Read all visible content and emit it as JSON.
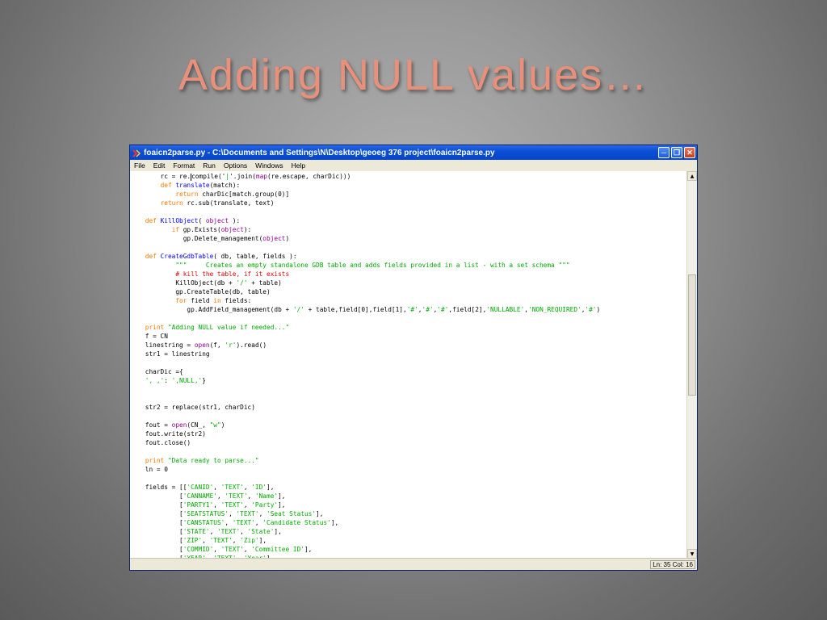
{
  "slide": {
    "title": "Adding NULL values…"
  },
  "window": {
    "title": "foaicn2parse.py - C:\\Documents and Settings\\N\\Desktop\\geoeg 376 project\\foaicn2parse.py",
    "menu": [
      "File",
      "Edit",
      "Format",
      "Run",
      "Options",
      "Windows",
      "Help"
    ],
    "status": "Ln: 35 Col: 16"
  },
  "code": [
    [
      [
        "",
        "        rc = re."
      ],
      [
        "",
        "compile"
      ],
      [
        "",
        "('"
      ],
      [
        "st",
        "|"
      ],
      [
        "",
        "'.join("
      ],
      [
        "bi",
        "map"
      ],
      [
        "",
        "(re.escape, charDic)))"
      ]
    ],
    [
      [
        "",
        "        "
      ],
      [
        "kw",
        "def "
      ],
      [
        "fn",
        "translate"
      ],
      [
        "",
        "(match):"
      ]
    ],
    [
      [
        "",
        "            "
      ],
      [
        "kw",
        "return "
      ],
      [
        "",
        "charDic[match.group(0)]"
      ]
    ],
    [
      [
        "",
        "        "
      ],
      [
        "kw",
        "return "
      ],
      [
        "",
        "rc.sub(translate, text)"
      ]
    ],
    [
      [
        "",
        ""
      ]
    ],
    [
      [
        "kw",
        "    def "
      ],
      [
        "fn",
        "KillObject"
      ],
      [
        "",
        "( "
      ],
      [
        "bi",
        "object"
      ],
      [
        "",
        " ):"
      ]
    ],
    [
      [
        "",
        "           "
      ],
      [
        "kw",
        "if "
      ],
      [
        "",
        "gp.Exists("
      ],
      [
        "bi",
        "object"
      ],
      [
        "",
        "):"
      ]
    ],
    [
      [
        "",
        "              gp.Delete_management("
      ],
      [
        "bi",
        "object"
      ],
      [
        "",
        ")"
      ]
    ],
    [
      [
        "",
        ""
      ]
    ],
    [
      [
        "kw",
        "    def "
      ],
      [
        "fn",
        "CreateGdbTable"
      ],
      [
        "",
        "( db, table, fields ):"
      ]
    ],
    [
      [
        "",
        "            "
      ],
      [
        "st",
        "\"\"\"     Creates an empty standalone GDB table and adds fields provided in a list - with a set schema \"\"\""
      ]
    ],
    [
      [
        "",
        "            "
      ],
      [
        "cm",
        "# kill the table, if it exists"
      ]
    ],
    [
      [
        "",
        "            KillObject(db + "
      ],
      [
        "st",
        "'/'"
      ],
      [
        "",
        " + table)"
      ]
    ],
    [
      [
        "",
        "            gp.CreateTable(db, table)"
      ]
    ],
    [
      [
        "",
        "            "
      ],
      [
        "kw",
        "for "
      ],
      [
        "",
        "field "
      ],
      [
        "kw",
        "in "
      ],
      [
        "",
        "fields:"
      ]
    ],
    [
      [
        "",
        "               gp.AddField_management(db + "
      ],
      [
        "st",
        "'/'"
      ],
      [
        "",
        " + table,field[0],field[1],"
      ],
      [
        "st",
        "'#'"
      ],
      [
        "",
        ","
      ],
      [
        "st",
        "'#'"
      ],
      [
        "",
        ","
      ],
      [
        "st",
        "'#'"
      ],
      [
        "",
        ",field[2],"
      ],
      [
        "st",
        "'NULLABLE'"
      ],
      [
        "",
        ","
      ],
      [
        "st",
        "'NON_REQUIRED'"
      ],
      [
        "",
        ","
      ],
      [
        "st",
        "'#'"
      ],
      [
        "",
        ")"
      ]
    ],
    [
      [
        "",
        ""
      ]
    ],
    [
      [
        "kw",
        "    print "
      ],
      [
        "st",
        "\"Adding NULL value if needed...\""
      ]
    ],
    [
      [
        "",
        "    f = CN"
      ]
    ],
    [
      [
        "",
        "    linestring = "
      ],
      [
        "bi",
        "open"
      ],
      [
        "",
        "(f, "
      ],
      [
        "st",
        "'r'"
      ],
      [
        "",
        ").read()"
      ]
    ],
    [
      [
        "",
        "    str1 = linestring"
      ]
    ],
    [
      [
        "",
        ""
      ]
    ],
    [
      [
        "",
        "    charDic ={"
      ]
    ],
    [
      [
        "",
        "    "
      ],
      [
        "st",
        "', ,'"
      ],
      [
        "",
        ": "
      ],
      [
        "st",
        "',NULL,'"
      ],
      [
        "",
        "}"
      ]
    ],
    [
      [
        "",
        ""
      ]
    ],
    [
      [
        "",
        ""
      ]
    ],
    [
      [
        "",
        "    str2 = replace(str1, charDic)"
      ]
    ],
    [
      [
        "",
        ""
      ]
    ],
    [
      [
        "",
        "    fout = "
      ],
      [
        "bi",
        "open"
      ],
      [
        "",
        "(CN_, "
      ],
      [
        "st",
        "\"w\""
      ],
      [
        "",
        ")"
      ]
    ],
    [
      [
        "",
        "    fout.write(str2)"
      ]
    ],
    [
      [
        "",
        "    fout.close()"
      ]
    ],
    [
      [
        "",
        ""
      ]
    ],
    [
      [
        "kw",
        "    print "
      ],
      [
        "st",
        "\"Data ready to parse...\""
      ]
    ],
    [
      [
        "",
        "    ln = 0"
      ]
    ],
    [
      [
        "",
        ""
      ]
    ],
    [
      [
        "",
        "    fields = [["
      ],
      [
        "st",
        "'CANID'"
      ],
      [
        "",
        ", "
      ],
      [
        "st",
        "'TEXT'"
      ],
      [
        "",
        ", "
      ],
      [
        "st",
        "'ID'"
      ],
      [
        "",
        "],"
      ]
    ],
    [
      [
        "",
        "             ["
      ],
      [
        "st",
        "'CANNAME'"
      ],
      [
        "",
        ", "
      ],
      [
        "st",
        "'TEXT'"
      ],
      [
        "",
        ", "
      ],
      [
        "st",
        "'Name'"
      ],
      [
        "",
        "],"
      ]
    ],
    [
      [
        "",
        "             ["
      ],
      [
        "st",
        "'PARTY1'"
      ],
      [
        "",
        ", "
      ],
      [
        "st",
        "'TEXT'"
      ],
      [
        "",
        ", "
      ],
      [
        "st",
        "'Party'"
      ],
      [
        "",
        "],"
      ]
    ],
    [
      [
        "",
        "             ["
      ],
      [
        "st",
        "'SEATSTATUS'"
      ],
      [
        "",
        ", "
      ],
      [
        "st",
        "'TEXT'"
      ],
      [
        "",
        ", "
      ],
      [
        "st",
        "'Seat Status'"
      ],
      [
        "",
        "],"
      ]
    ],
    [
      [
        "",
        "             ["
      ],
      [
        "st",
        "'CANSTATUS'"
      ],
      [
        "",
        ", "
      ],
      [
        "st",
        "'TEXT'"
      ],
      [
        "",
        ", "
      ],
      [
        "st",
        "'Candidate Status'"
      ],
      [
        "",
        "],"
      ]
    ],
    [
      [
        "",
        "             ["
      ],
      [
        "st",
        "'STATE'"
      ],
      [
        "",
        ", "
      ],
      [
        "st",
        "'TEXT'"
      ],
      [
        "",
        ", "
      ],
      [
        "st",
        "'State'"
      ],
      [
        "",
        "],"
      ]
    ],
    [
      [
        "",
        "             ["
      ],
      [
        "st",
        "'ZIP'"
      ],
      [
        "",
        ", "
      ],
      [
        "st",
        "'TEXT'"
      ],
      [
        "",
        ", "
      ],
      [
        "st",
        "'Zip'"
      ],
      [
        "",
        "],"
      ]
    ],
    [
      [
        "",
        "             ["
      ],
      [
        "st",
        "'COMMID'"
      ],
      [
        "",
        ", "
      ],
      [
        "st",
        "'TEXT'"
      ],
      [
        "",
        ", "
      ],
      [
        "st",
        "'Committee ID'"
      ],
      [
        "",
        "],"
      ]
    ],
    [
      [
        "",
        "             ["
      ],
      [
        "st",
        "'YEAR'"
      ],
      [
        "",
        ", "
      ],
      [
        "st",
        "'TEXT'"
      ],
      [
        "",
        ", "
      ],
      [
        "st",
        "'Year'"
      ],
      [
        "",
        "],"
      ]
    ]
  ]
}
